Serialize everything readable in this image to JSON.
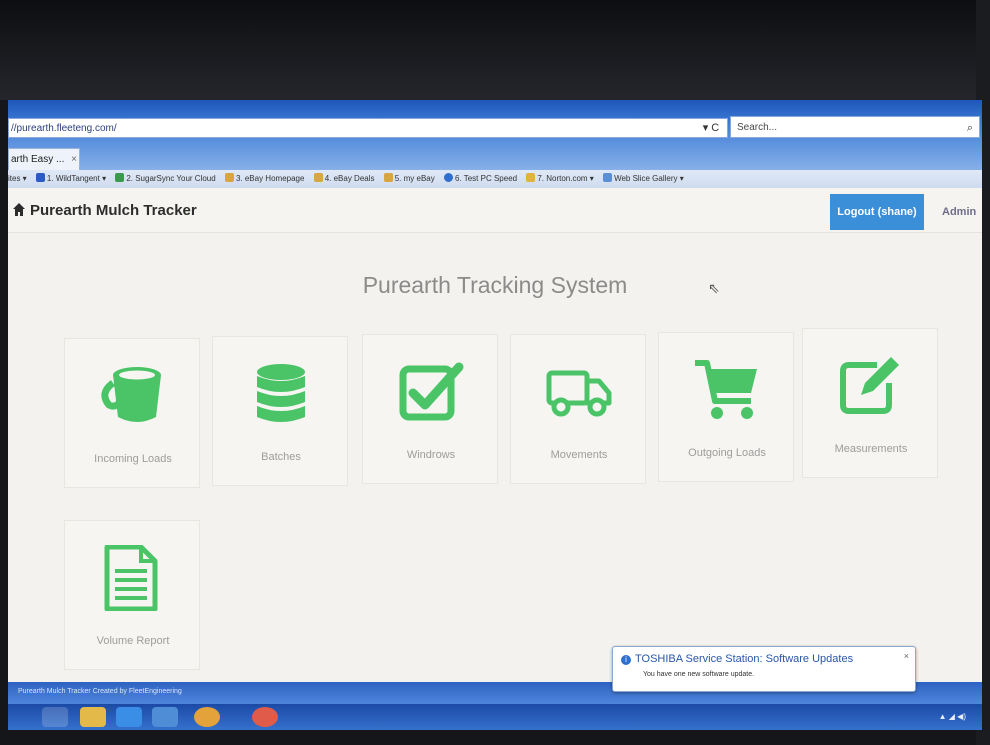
{
  "browser": {
    "url": "//purearth.fleeteng.com/",
    "refresh_label": "▾ C",
    "search_placeholder": "Search...",
    "tab_title": "arth Easy ...",
    "favorites": [
      "ites ▾",
      "1. WildTangent ▾",
      "2. SugarSync Your Cloud",
      "3. eBay Homepage",
      "4. eBay Deals",
      "5. my eBay",
      "6. Test PC Speed",
      "7. Norton.com ▾",
      "Web Slice Gallery ▾"
    ]
  },
  "navbar": {
    "brand": "Purearth Mulch Tracker",
    "logout": "Logout (shane)",
    "admin": "Admin"
  },
  "main": {
    "heading": "Purearth Tracking System",
    "tiles": [
      {
        "label": "Incoming Loads",
        "icon": "bucket-icon"
      },
      {
        "label": "Batches",
        "icon": "database-icon"
      },
      {
        "label": "Windrows",
        "icon": "checkbox-icon"
      },
      {
        "label": "Movements",
        "icon": "truck-icon"
      },
      {
        "label": "Outgoing Loads",
        "icon": "cart-icon"
      },
      {
        "label": "Measurements",
        "icon": "edit-icon"
      },
      {
        "label": "Volume Report",
        "icon": "document-icon"
      }
    ]
  },
  "footer": {
    "text": "Purearth Mulch Tracker Created by FleetEngineering"
  },
  "notification": {
    "title": "TOSHIBA Service Station: Software Updates",
    "body": "You have one new software update."
  },
  "colors": {
    "accent_green": "#4bc467",
    "logout_blue": "#3a8fd8",
    "taskbar_blue": "#2a5fbd"
  }
}
